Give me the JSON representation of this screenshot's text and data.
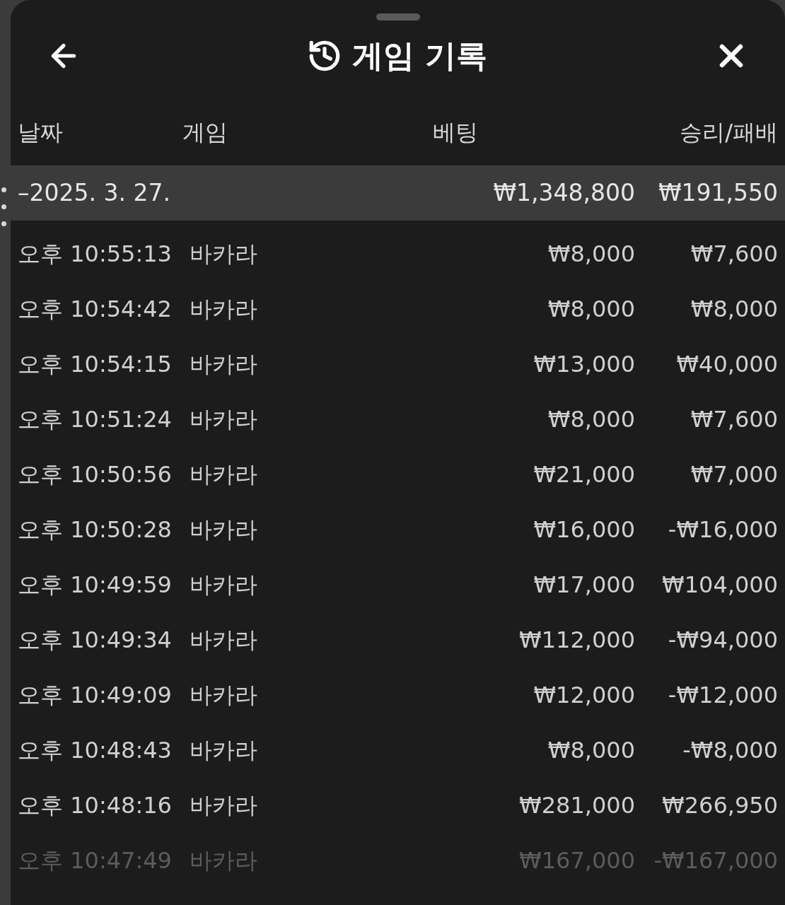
{
  "header": {
    "title": "게임 기록"
  },
  "columns": [
    "날짜",
    "게임",
    "베팅",
    "승리/패배"
  ],
  "group": {
    "label": "–2025. 3. 27.",
    "bet": "₩1,348,800",
    "result": "₩191,550"
  },
  "rows": [
    {
      "time": "오후 10:55:13",
      "game": "바카라",
      "bet": "₩8,000",
      "result": "₩7,600",
      "faded": false
    },
    {
      "time": "오후 10:54:42",
      "game": "바카라",
      "bet": "₩8,000",
      "result": "₩8,000",
      "faded": false
    },
    {
      "time": "오후 10:54:15",
      "game": "바카라",
      "bet": "₩13,000",
      "result": "₩40,000",
      "faded": false
    },
    {
      "time": "오후 10:51:24",
      "game": "바카라",
      "bet": "₩8,000",
      "result": "₩7,600",
      "faded": false
    },
    {
      "time": "오후 10:50:56",
      "game": "바카라",
      "bet": "₩21,000",
      "result": "₩7,000",
      "faded": false
    },
    {
      "time": "오후 10:50:28",
      "game": "바카라",
      "bet": "₩16,000",
      "result": "-₩16,000",
      "faded": false
    },
    {
      "time": "오후 10:49:59",
      "game": "바카라",
      "bet": "₩17,000",
      "result": "₩104,000",
      "faded": false
    },
    {
      "time": "오후 10:49:34",
      "game": "바카라",
      "bet": "₩112,000",
      "result": "-₩94,000",
      "faded": false
    },
    {
      "time": "오후 10:49:09",
      "game": "바카라",
      "bet": "₩12,000",
      "result": "-₩12,000",
      "faded": false
    },
    {
      "time": "오후 10:48:43",
      "game": "바카라",
      "bet": "₩8,000",
      "result": "-₩8,000",
      "faded": false
    },
    {
      "time": "오후 10:48:16",
      "game": "바카라",
      "bet": "₩281,000",
      "result": "₩266,950",
      "faded": false
    },
    {
      "time": "오후 10:47:49",
      "game": "바카라",
      "bet": "₩167,000",
      "result": "-₩167,000",
      "faded": true
    }
  ]
}
